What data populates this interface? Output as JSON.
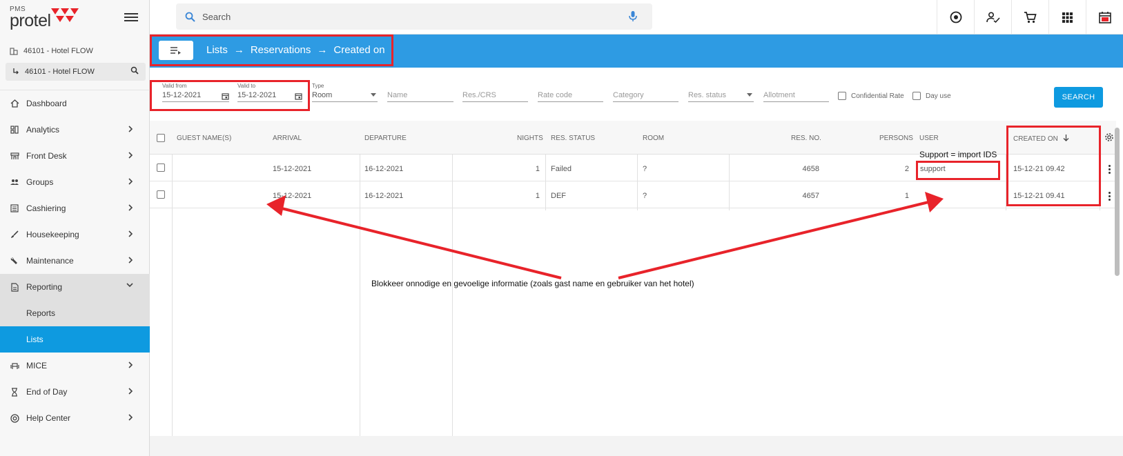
{
  "sidebar": {
    "logo_small": "PMS",
    "logo_brand": "protel",
    "hotel_label": "46101 - Hotel FLOW",
    "hotel_selected": "46101 - Hotel FLOW",
    "items": [
      {
        "label": "Dashboard",
        "icon": "home-icon",
        "chevron": false
      },
      {
        "label": "Analytics",
        "icon": "analytics-icon",
        "chevron": true
      },
      {
        "label": "Front Desk",
        "icon": "front-desk-icon",
        "chevron": true
      },
      {
        "label": "Groups",
        "icon": "groups-icon",
        "chevron": true
      },
      {
        "label": "Cashiering",
        "icon": "cashiering-icon",
        "chevron": true
      },
      {
        "label": "Housekeeping",
        "icon": "brush-icon",
        "chevron": true
      },
      {
        "label": "Maintenance",
        "icon": "wrench-icon",
        "chevron": true
      },
      {
        "label": "Reporting",
        "icon": "report-icon",
        "chevron": true
      },
      {
        "label": "MICE",
        "icon": "mice-icon",
        "chevron": true
      },
      {
        "label": "End of Day",
        "icon": "hourglass-icon",
        "chevron": true
      },
      {
        "label": "Help Center",
        "icon": "help-icon",
        "chevron": true
      }
    ],
    "sub_items": [
      {
        "label": "Reports"
      },
      {
        "label": "Lists"
      }
    ]
  },
  "topbar": {
    "search_placeholder": "Search"
  },
  "header": {
    "crumbs": [
      "Lists",
      "Reservations",
      "Created on"
    ],
    "arrow": "→"
  },
  "filters": {
    "valid_from_label": "Valid from",
    "valid_from_value": "15-12-2021",
    "valid_to_label": "Valid to",
    "valid_to_value": "15-12-2021",
    "type_label": "Type",
    "type_value": "Room",
    "name_placeholder": "Name",
    "rescrs_placeholder": "Res./CRS",
    "ratecode_placeholder": "Rate code",
    "category_placeholder": "Category",
    "resstatus_placeholder": "Res. status",
    "allotment_placeholder": "Allotment",
    "confidential_label": "Confidential Rate",
    "dayuse_label": "Day use",
    "search_button": "SEARCH"
  },
  "table": {
    "headers": {
      "guest": "GUEST NAME(S)",
      "arrival": "ARRIVAL",
      "departure": "DEPARTURE",
      "nights": "NIGHTS",
      "status": "RES. STATUS",
      "room": "ROOM",
      "resno": "RES. NO.",
      "persons": "PERSONS",
      "user": "USER",
      "created": "CREATED ON"
    },
    "rows": [
      {
        "guest": "",
        "arrival": "15-12-2021",
        "departure": "16-12-2021",
        "nights": "1",
        "status": "Failed",
        "room": "?",
        "resno": "4658",
        "persons": "2",
        "user": "support",
        "created": "15-12-21 09.42"
      },
      {
        "guest": "",
        "arrival": "15-12-2021",
        "departure": "16-12-2021",
        "nights": "1",
        "status": "DEF",
        "room": "?",
        "resno": "4657",
        "persons": "1",
        "user": "",
        "created": "15-12-21 09.41"
      }
    ]
  },
  "annotations": {
    "user_note": "Support = import IDS",
    "main_note": "Blokkeer onnodige en gevoelige informatie (zoals gast name en gebruiker van het hotel)",
    "color": "#e8232a"
  }
}
